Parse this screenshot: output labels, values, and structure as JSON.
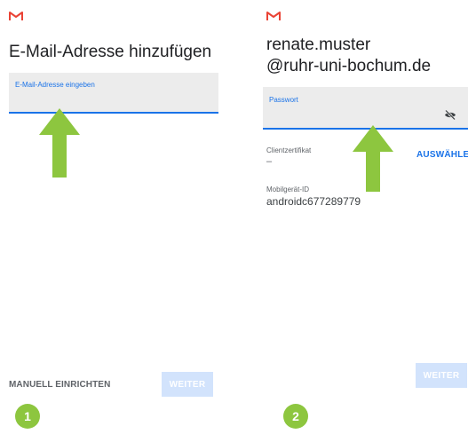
{
  "panel1": {
    "title": "E-Mail-Adresse hinzufügen",
    "email_field_label": "E-Mail-Adresse eingeben",
    "manual_setup_label": "MANUELL EINRICHTEN",
    "next_label": "WEITER",
    "step_number": "1"
  },
  "panel2": {
    "email_line1": "renate.muster",
    "email_line2": "@ruhr-uni-bochum.de",
    "password_field_label": "Passwort",
    "client_cert_label": "Clientzertifikat",
    "client_cert_value": "–",
    "select_label": "AUSWÄHLEN",
    "device_id_label": "Mobilgerät-ID",
    "device_id_value": "androidc677289779",
    "next_label": "WEITER",
    "step_number": "2"
  },
  "colors": {
    "accent": "#1a73e8",
    "gmail_red": "#ea4335",
    "arrow_green": "#8dc63f",
    "disabled_button": "#d2e3fc",
    "field_bg": "#ececec"
  },
  "icons": {
    "logo": "gmail-logo-icon",
    "password_toggle": "eye-off-icon",
    "annotation": "arrow-up-icon"
  }
}
